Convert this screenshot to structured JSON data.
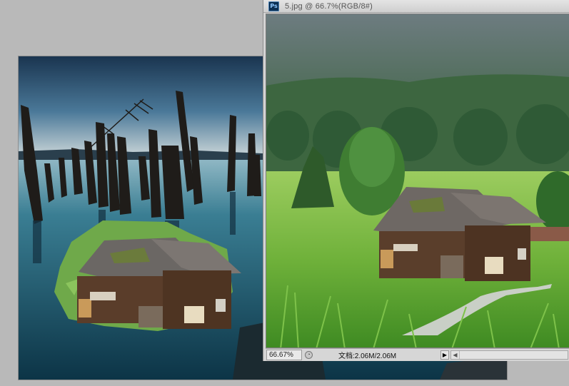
{
  "window": {
    "ps_badge": "Ps",
    "title": "5.jpg @ 66.7%(RGB/8#)"
  },
  "statusbar": {
    "zoom": "66.67%",
    "doc_info": "文档:2.06M/2.06M",
    "arrow_right": "▶",
    "arrow_left": "◀"
  },
  "icons": {
    "app": "photoshop-icon",
    "status": "document-status-icon"
  }
}
